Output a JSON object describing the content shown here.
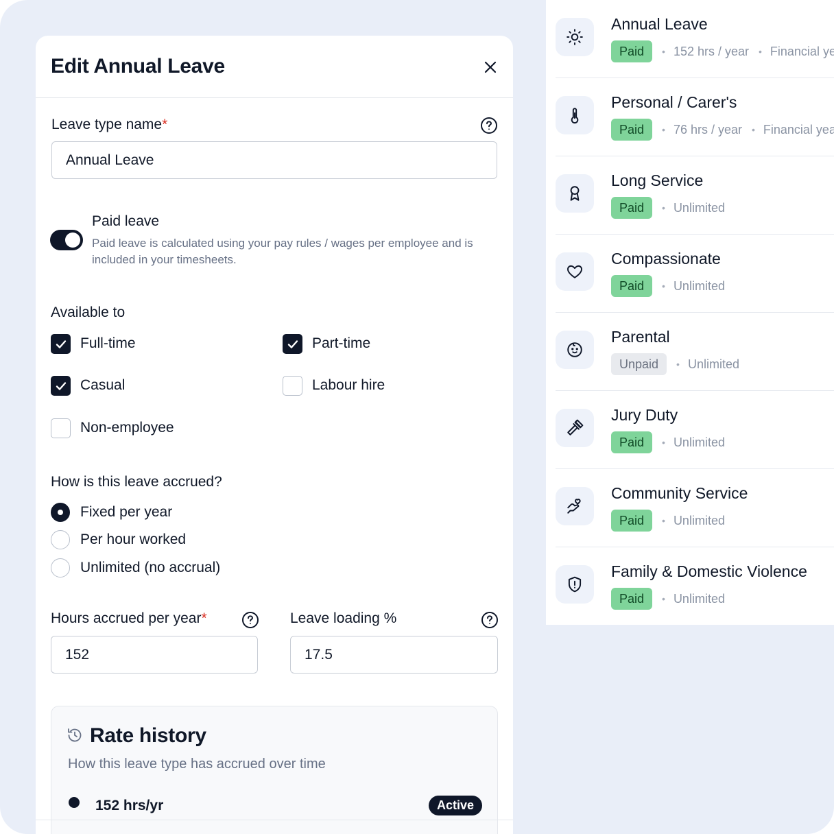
{
  "modal": {
    "title": "Edit Annual Leave",
    "name_label": "Leave type name",
    "required_mark": "*",
    "name_value": "Annual Leave",
    "paid_toggle_on": true,
    "paid_title": "Paid leave",
    "paid_description": "Paid leave is calculated using your pay rules / wages per employee and is included in your timesheets.",
    "available_label": "Available to",
    "available_options": [
      {
        "label": "Full-time",
        "checked": true
      },
      {
        "label": "Part-time",
        "checked": true
      },
      {
        "label": "Casual",
        "checked": true
      },
      {
        "label": "Labour hire",
        "checked": false
      },
      {
        "label": "Non-employee",
        "checked": false
      }
    ],
    "accrual_label": "How is this leave accrued?",
    "accrual_options": [
      {
        "label": "Fixed per year",
        "selected": true
      },
      {
        "label": "Per hour worked",
        "selected": false
      },
      {
        "label": "Unlimited (no accrual)",
        "selected": false
      }
    ],
    "hours_label": "Hours accrued per year",
    "hours_value": "152",
    "loading_label": "Leave loading %",
    "loading_value": "17.5",
    "rate_history": {
      "title": "Rate history",
      "subtitle": "How this leave type has accrued over time",
      "entries": [
        {
          "value": "152 hrs/yr",
          "status": "Active"
        }
      ]
    }
  },
  "leave_types": [
    {
      "name": "Annual Leave",
      "badge": "Paid",
      "meta": [
        "152 hrs / year",
        "Financial year"
      ],
      "icon": "sun-icon"
    },
    {
      "name": "Personal / Carer's",
      "badge": "Paid",
      "meta": [
        "76 hrs / year",
        "Financial year"
      ],
      "icon": "thermometer-icon"
    },
    {
      "name": "Long Service",
      "badge": "Paid",
      "meta": [
        "Unlimited"
      ],
      "icon": "award-icon"
    },
    {
      "name": "Compassionate",
      "badge": "Paid",
      "meta": [
        "Unlimited"
      ],
      "icon": "heart-icon"
    },
    {
      "name": "Parental",
      "badge": "Unpaid",
      "meta": [
        "Unlimited"
      ],
      "icon": "baby-icon"
    },
    {
      "name": "Jury Duty",
      "badge": "Paid",
      "meta": [
        "Unlimited"
      ],
      "icon": "gavel-icon"
    },
    {
      "name": "Community Service",
      "badge": "Paid",
      "meta": [
        "Unlimited"
      ],
      "icon": "hand-heart-icon"
    },
    {
      "name": "Family & Domestic Violence",
      "badge": "Paid",
      "meta": [
        "Unlimited"
      ],
      "icon": "shield-alert-icon"
    }
  ],
  "colors": {
    "primary": "#0f1729",
    "paid_badge_bg": "#7fd49a",
    "unpaid_badge_bg": "#e8eaee",
    "required": "#d92d20",
    "background": "#e9eef8"
  }
}
